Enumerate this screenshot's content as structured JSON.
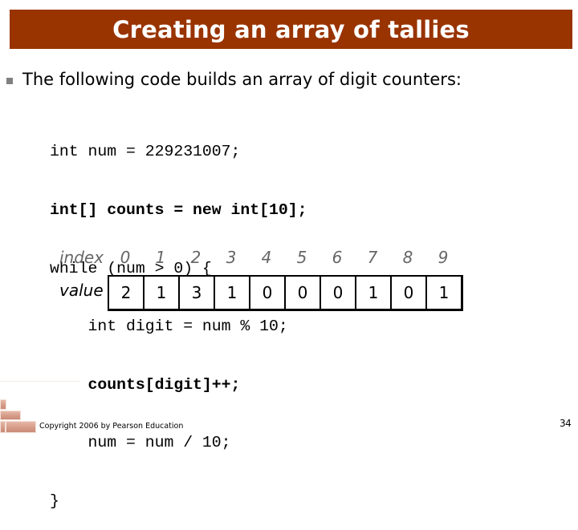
{
  "slide": {
    "title": "Creating an array of tallies",
    "title_bar_color": "#993300",
    "bullet_text": "The following code builds an array of digit counters:",
    "code_lines": [
      {
        "text": "int num = 229231007;",
        "bold": false
      },
      {
        "text": "int[] counts = new int[10];",
        "bold": true
      },
      {
        "text": "while (num > 0) {",
        "bold": false
      },
      {
        "text": "    int digit = num % 10;",
        "bold": false
      },
      {
        "text": "    counts[digit]++;",
        "bold": true
      },
      {
        "text": "    num = num / 10;",
        "bold": false
      },
      {
        "text": "}",
        "bold": false
      }
    ],
    "array_table": {
      "index_label": "index",
      "value_label": "value",
      "indices": [
        "0",
        "1",
        "2",
        "3",
        "4",
        "5",
        "6",
        "7",
        "8",
        "9"
      ],
      "values": [
        "2",
        "1",
        "3",
        "1",
        "0",
        "0",
        "0",
        "1",
        "0",
        "1"
      ]
    },
    "footer": {
      "copyright": "Copyright 2006 by Pearson Education",
      "page_number": "34",
      "decoration": "brick-icon"
    }
  }
}
